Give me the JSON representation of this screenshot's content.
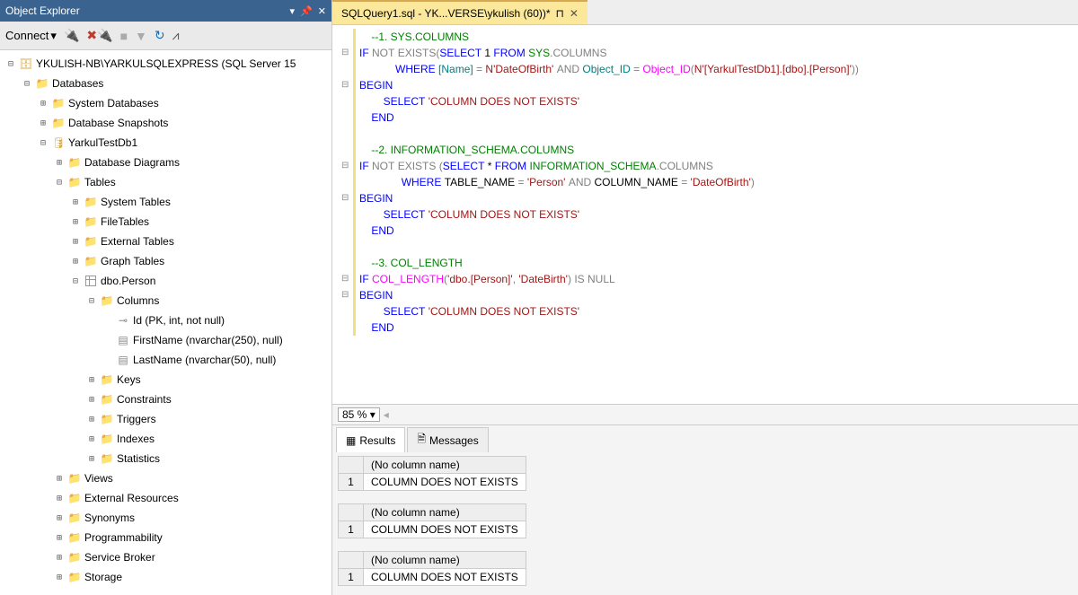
{
  "panel": {
    "title": "Object Explorer",
    "connect_label": "Connect"
  },
  "tree": {
    "server": "YKULISH-NB\\YARKULSQLEXPRESS (SQL Server 15",
    "databases": "Databases",
    "sys_db": "System Databases",
    "db_snap": "Database Snapshots",
    "db_name": "YarkulTestDb1",
    "db_diag": "Database Diagrams",
    "tables": "Tables",
    "sys_tables": "System Tables",
    "file_tables": "FileTables",
    "ext_tables": "External Tables",
    "graph_tables": "Graph Tables",
    "table_person": "dbo.Person",
    "columns": "Columns",
    "col_id": "Id (PK, int, not null)",
    "col_first": "FirstName (nvarchar(250), null)",
    "col_last": "LastName (nvarchar(50), null)",
    "keys": "Keys",
    "constraints": "Constraints",
    "triggers": "Triggers",
    "indexes": "Indexes",
    "statistics": "Statistics",
    "views": "Views",
    "ext_res": "External Resources",
    "synonyms": "Synonyms",
    "prog": "Programmability",
    "svc_broker": "Service Broker",
    "storage": "Storage"
  },
  "tab": {
    "title": "SQLQuery1.sql - YK...VERSE\\ykulish (60))*",
    "pin": "⊓",
    "close": "✕"
  },
  "zoom": {
    "value": "85 %"
  },
  "resultTabs": {
    "results": "Results",
    "messages": "Messages"
  },
  "results": {
    "header": "(No column name)",
    "rownum": "1",
    "value": "COLUMN DOES NOT EXISTS"
  },
  "code": {
    "l1": "    --1. SYS.COLUMNS",
    "l3_indent": "            ",
    "l6_indent": "        ",
    "l9": "    --2. INFORMATION_SCHEMA.COLUMNS",
    "l15": "    --3. COL_LENGTH",
    "where": "WHERE",
    "select": "SELECT",
    "from": "FROM",
    "and": "AND",
    "begin": "BEGIN",
    "end": "END",
    "if": "IF",
    "not": "NOT",
    "exists": "EXISTS",
    "isnull": "IS",
    "null": "NULL",
    "name_br": "[Name]",
    "eq": " = ",
    "n_dob": "N'DateOfBirth'",
    "obj_id": "Object_ID",
    "obj_id_call": "Object_ID",
    "obj_arg": "N'[YarkulTestDb1].[dbo].[Person]'",
    "sys_columns": "SYS",
    "sys_columns2": ".COLUMNS",
    "info_schema": "INFORMATION_SCHEMA",
    "info_schema2": ".COLUMNS",
    "tbl_name": "TABLE_NAME",
    "col_name": "COLUMN_NAME",
    "person": "'Person'",
    "dob": "'DateOfBirth'",
    "dne": "'COLUMN DOES NOT EXISTS'",
    "col_length": "COL_LENGTH",
    "dbo_person": "'dbo.[Person]'",
    "datebirth": "'DateBirth'",
    "one": " 1 ",
    "star": " * "
  }
}
